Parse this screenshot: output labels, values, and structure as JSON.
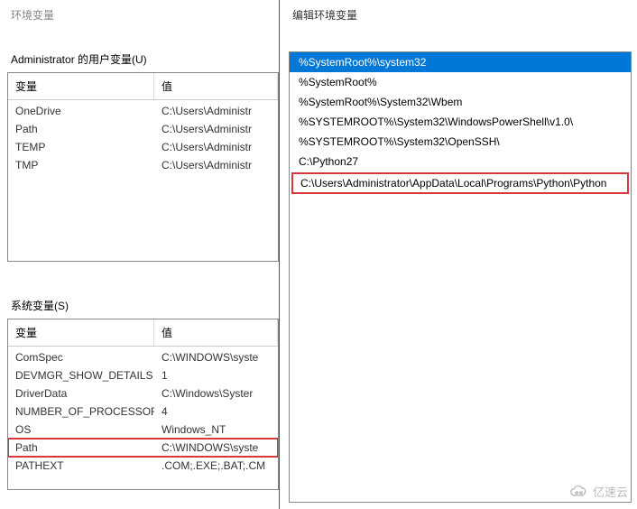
{
  "left": {
    "dialog_title": "环境变量",
    "user_section_label": "Administrator 的用户变量(U)",
    "sys_section_label": "系统变量(S)",
    "th_name": "变量",
    "th_value": "值",
    "user_vars": [
      {
        "name": "OneDrive",
        "value": "C:\\Users\\Administr"
      },
      {
        "name": "Path",
        "value": "C:\\Users\\Administr"
      },
      {
        "name": "TEMP",
        "value": "C:\\Users\\Administr"
      },
      {
        "name": "TMP",
        "value": "C:\\Users\\Administr"
      }
    ],
    "sys_vars": [
      {
        "name": "ComSpec",
        "value": "C:\\WINDOWS\\syste",
        "highlight": false
      },
      {
        "name": "DEVMGR_SHOW_DETAILS",
        "value": "1",
        "highlight": false
      },
      {
        "name": "DriverData",
        "value": "C:\\Windows\\Syster",
        "highlight": false
      },
      {
        "name": "NUMBER_OF_PROCESSORS",
        "value": "4",
        "highlight": false
      },
      {
        "name": "OS",
        "value": "Windows_NT",
        "highlight": false
      },
      {
        "name": "Path",
        "value": "C:\\WINDOWS\\syste",
        "highlight": true
      },
      {
        "name": "PATHEXT",
        "value": ".COM;.EXE;.BAT;.CM",
        "highlight": false
      }
    ]
  },
  "right": {
    "dialog_title": "编辑环境变量",
    "path_entries": [
      {
        "text": "%SystemRoot%\\system32",
        "selected": true
      },
      {
        "text": "%SystemRoot%",
        "selected": false
      },
      {
        "text": "%SystemRoot%\\System32\\Wbem",
        "selected": false
      },
      {
        "text": "%SYSTEMROOT%\\System32\\WindowsPowerShell\\v1.0\\",
        "selected": false
      },
      {
        "text": "%SYSTEMROOT%\\System32\\OpenSSH\\",
        "selected": false
      },
      {
        "text": "C:\\Python27",
        "selected": false
      }
    ],
    "highlighted_entry": "C:\\Users\\Administrator\\AppData\\Local\\Programs\\Python\\Python"
  },
  "watermark": "亿速云"
}
